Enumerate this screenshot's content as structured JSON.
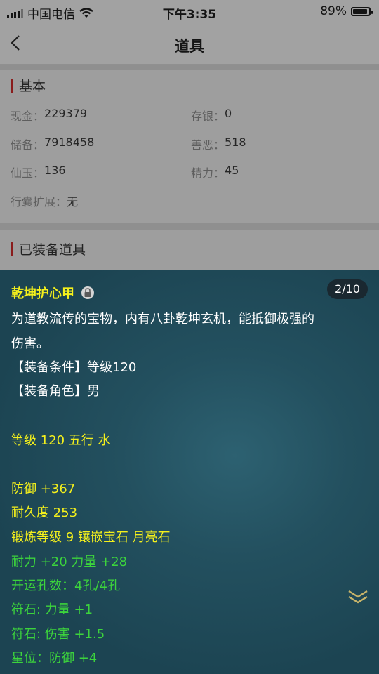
{
  "status_bar": {
    "carrier": "中国电信",
    "time": "下午3:35",
    "battery": "89%",
    "battery_level": 0.89
  },
  "nav": {
    "title": "道具"
  },
  "basic": {
    "title": "基本",
    "rows": [
      {
        "label": "现金：",
        "value": "229379"
      },
      {
        "label": "存银：",
        "value": "0"
      },
      {
        "label": "储备：",
        "value": "7918458"
      },
      {
        "label": "善恶：",
        "value": "518"
      },
      {
        "label": "仙玉：",
        "value": "136"
      },
      {
        "label": "精力：",
        "value": "45"
      },
      {
        "label": "行囊扩展：",
        "value": "无"
      }
    ]
  },
  "equipped": {
    "title": "已装备道具"
  },
  "item": {
    "name": "乾坤护心甲",
    "page": "2/10",
    "desc_line1": "为道教流传的宝物，内有八卦乾坤玄机，能抵御极强的",
    "desc_line2": "伤害。",
    "condition": "【装备条件】等级120",
    "role": "【装备角色】男",
    "level_line": "等级 120 五行 水",
    "defense": "防御 +367",
    "durability": "耐久度 253",
    "forge": "锻炼等级 9 镶嵌宝石 月亮石",
    "stats": "耐力 +20 力量 +28",
    "holes": "开运孔数：4孔/4孔",
    "rune1": "符石: 力量 +1",
    "rune2": "符石: 伤害 +1.5",
    "star": "星位：防御 +4"
  }
}
